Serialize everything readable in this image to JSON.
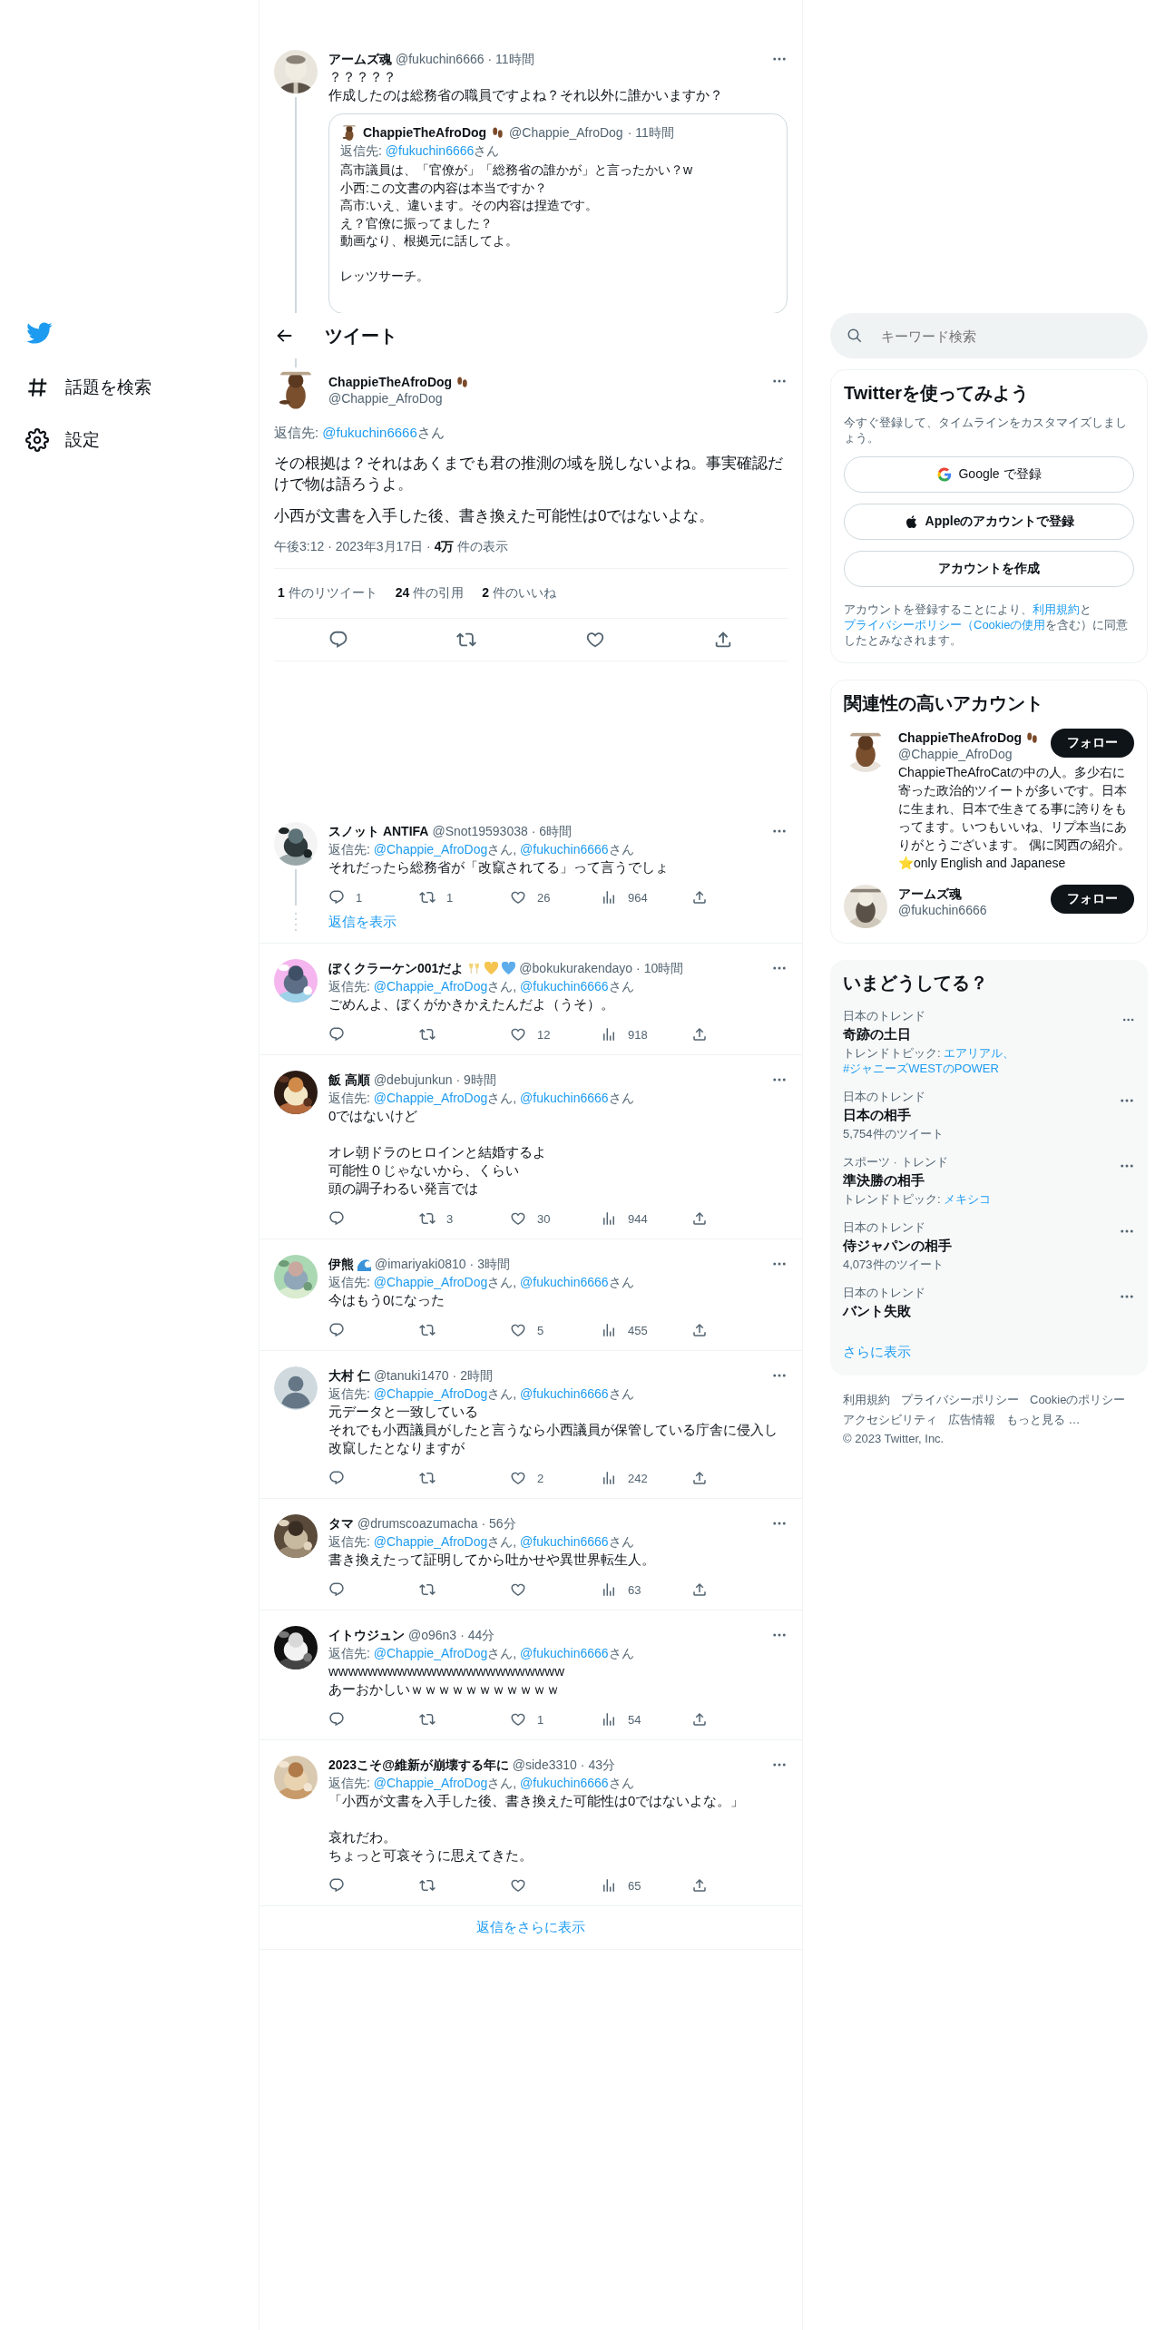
{
  "sidebar": {
    "items": [
      {
        "kind": "logo"
      },
      {
        "kind": "explore",
        "label": "話題を検索"
      },
      {
        "kind": "settings",
        "label": "設定"
      }
    ]
  },
  "parent_tweet": {
    "avatar": {
      "kind": "picture"
    },
    "name": "アームズ魂",
    "handle": "@fukuchin6666",
    "time": "· 11時間",
    "text": [
      [
        "？？？？？",
        "作成したのは総務省の職員ですよね？それ以外に誰かいますか？"
      ]
    ],
    "quote": {
      "avatar": {
        "kind": "picture"
      },
      "name": "ChappieTheAfroDog",
      "name_icons": [
        {
          "kind": "footprints"
        }
      ],
      "handle": "@Chappie_AfroDog",
      "time": "· 11時間",
      "reply_to": {
        "label": "返信先: ",
        "parts": [
          {
            "kind": "mention",
            "text": "@fukuchin6666"
          },
          {
            "kind": "plain",
            "text": "さん"
          }
        ]
      },
      "text": [
        [
          "高市議員は、「官僚が」「総務省の誰かが」と言ったかい？w",
          "小西:この文書の内容は本当ですか？",
          "高市:いえ、違います。その内容は捏造です。",
          "え？官僚に振ってました？",
          "動画なり、根拠元に話してよ。"
        ],
        [
          "レッツサーチ。"
        ]
      ]
    }
  },
  "header": {
    "title": "ツイート"
  },
  "main_tweet": {
    "avatar": {
      "kind": "picture"
    },
    "name": "ChappieTheAfroDog",
    "name_icons": [
      {
        "kind": "footprints"
      }
    ],
    "handle": "@Chappie_AfroDog",
    "reply_to": {
      "label": "返信先: ",
      "parts": [
        {
          "kind": "mention",
          "text": "@fukuchin6666"
        },
        {
          "kind": "plain",
          "text": "さん"
        }
      ]
    },
    "paragraphs": [
      "その根拠は？それはあくまでも君の推測の域を脱しないよね。事実確認だけで物は語ろうよ。",
      "小西が文書を入手した後、書き換えた可能性は0ではないよな。"
    ],
    "meta": "午後3:12 · 2023年3月17日 · **4万** 件の表示",
    "stats": [
      "**1** 件のリツイート",
      "**24** 件の引用",
      "**2** 件のいいね"
    ]
  },
  "replies": [
    {
      "avatar": {
        "kind": "picture"
      },
      "name": "スノット ANTIFA",
      "handle": "@Snot19593038",
      "time": "· 6時間",
      "reply_to": {
        "label": "返信先: ",
        "parts": [
          {
            "kind": "mention",
            "text": "@Chappie_AfroDog"
          },
          {
            "kind": "plain",
            "text": "さん, "
          },
          {
            "kind": "mention",
            "text": "@fukuchin6666"
          },
          {
            "kind": "plain",
            "text": "さん"
          }
        ]
      },
      "text": [
        [
          "それだったら総務省が「改竄されてる」って言うでしょ"
        ]
      ],
      "stats": {
        "reply": "1",
        "retweet": "1",
        "like": "26",
        "views": "964"
      },
      "show_replies": "返信を表示"
    },
    {
      "avatar": {
        "kind": "picture"
      },
      "name": "ぼくクラーケン001だよ",
      "name_icons": [
        {
          "kind": "glasses"
        },
        {
          "kind": "yellow-heart"
        },
        {
          "kind": "blue-heart"
        }
      ],
      "handle": "@bokukurakendayo",
      "time": "· 10時間",
      "reply_to": {
        "label": "返信先: ",
        "parts": [
          {
            "kind": "mention",
            "text": "@Chappie_AfroDog"
          },
          {
            "kind": "plain",
            "text": "さん, "
          },
          {
            "kind": "mention",
            "text": "@fukuchin6666"
          },
          {
            "kind": "plain",
            "text": "さん"
          }
        ]
      },
      "text": [
        [
          "ごめんよ、ぼくがかきかえたんだよ（うそ）。"
        ]
      ],
      "stats": {
        "like": "12",
        "views": "918"
      }
    },
    {
      "avatar": {
        "kind": "picture"
      },
      "name": "飯 高順",
      "handle": "@debujunkun",
      "time": "· 9時間",
      "reply_to": {
        "label": "返信先: ",
        "parts": [
          {
            "kind": "mention",
            "text": "@Chappie_AfroDog"
          },
          {
            "kind": "plain",
            "text": "さん, "
          },
          {
            "kind": "mention",
            "text": "@fukuchin6666"
          },
          {
            "kind": "plain",
            "text": "さん"
          }
        ]
      },
      "text": [
        [
          "0ではないけど"
        ],
        [
          "オレ朝ドラのヒロインと結婚するよ",
          "可能性０じゃないから、くらい",
          "頭の調子わるい発言では"
        ]
      ],
      "stats": {
        "retweet": "3",
        "like": "30",
        "views": "944"
      }
    },
    {
      "avatar": {
        "kind": "picture"
      },
      "name": "伊熊",
      "name_icons": [
        {
          "kind": "wave"
        }
      ],
      "handle": "@imariyaki0810",
      "time": "· 3時間",
      "reply_to": {
        "label": "返信先: ",
        "parts": [
          {
            "kind": "mention",
            "text": "@Chappie_AfroDog"
          },
          {
            "kind": "plain",
            "text": "さん, "
          },
          {
            "kind": "mention",
            "text": "@fukuchin6666"
          },
          {
            "kind": "plain",
            "text": "さん"
          }
        ]
      },
      "text": [
        [
          "今はもう0になった"
        ]
      ],
      "stats": {
        "like": "5",
        "views": "455"
      }
    },
    {
      "avatar": {
        "kind": "default"
      },
      "name": "大村 仁",
      "handle": "@tanuki1470",
      "time": "· 2時間",
      "reply_to": {
        "label": "返信先: ",
        "parts": [
          {
            "kind": "mention",
            "text": "@Chappie_AfroDog"
          },
          {
            "kind": "plain",
            "text": "さん, "
          },
          {
            "kind": "mention",
            "text": "@fukuchin6666"
          },
          {
            "kind": "plain",
            "text": "さん"
          }
        ]
      },
      "text": [
        [
          "元データと一致している",
          "それでも小西議員がしたと言うなら小西議員が保管している庁舎に侵入し改竄したとなりますが"
        ]
      ],
      "stats": {
        "like": "2",
        "views": "242"
      }
    },
    {
      "avatar": {
        "kind": "picture"
      },
      "name": "タマ",
      "handle": "@drumscoazumacha",
      "time": "· 56分",
      "reply_to": {
        "label": "返信先: ",
        "parts": [
          {
            "kind": "mention",
            "text": "@Chappie_AfroDog"
          },
          {
            "kind": "plain",
            "text": "さん, "
          },
          {
            "kind": "mention",
            "text": "@fukuchin6666"
          },
          {
            "kind": "plain",
            "text": "さん"
          }
        ]
      },
      "text": [
        [
          "書き換えたって証明してから吐かせや異世界転生人。"
        ]
      ],
      "stats": {
        "views": "63"
      }
    },
    {
      "avatar": {
        "kind": "picture"
      },
      "name": "イトウジュン",
      "handle": "@o96n3",
      "time": "· 44分",
      "reply_to": {
        "label": "返信先: ",
        "parts": [
          {
            "kind": "mention",
            "text": "@Chappie_AfroDog"
          },
          {
            "kind": "plain",
            "text": "さん, "
          },
          {
            "kind": "mention",
            "text": "@fukuchin6666"
          },
          {
            "kind": "plain",
            "text": "さん"
          }
        ]
      },
      "text": [
        [
          "wwwwwwwwwwwwwwwwwwwwwwww",
          "あーおかしいｗｗｗｗｗｗｗｗｗｗｗ"
        ]
      ],
      "stats": {
        "like": "1",
        "views": "54"
      }
    },
    {
      "avatar": {
        "kind": "picture"
      },
      "name": "2023こそ@維新が崩壊する年に",
      "handle": "@side3310",
      "time": "· 43分",
      "reply_to": {
        "label": "返信先: ",
        "parts": [
          {
            "kind": "mention",
            "text": "@Chappie_AfroDog"
          },
          {
            "kind": "plain",
            "text": "さん, "
          },
          {
            "kind": "mention",
            "text": "@fukuchin6666"
          },
          {
            "kind": "plain",
            "text": "さん"
          }
        ]
      },
      "text": [
        [
          "「小西が文書を入手した後、書き換えた可能性は0ではないよな。」"
        ],
        [
          "哀れだわ。",
          "ちょっと可哀そうに思えてきた。"
        ]
      ],
      "stats": {
        "views": "65"
      }
    }
  ],
  "show_more": "返信をさらに表示",
  "search": {
    "placeholder": "キーワード検索"
  },
  "signup": {
    "title": "Twitterを使ってみよう",
    "text": "今すぐ登録して、タイムラインをカスタマイズしましょう。",
    "buttons": [
      {
        "kind": "google",
        "label": "Google で登録"
      },
      {
        "kind": "apple",
        "label": "Appleのアカウントで登録"
      },
      {
        "kind": "plain",
        "label": "アカウントを作成"
      }
    ],
    "legal": [
      {
        "kind": "plain",
        "text": "アカウントを登録することにより、"
      },
      {
        "kind": "mention",
        "text": "利用規約"
      },
      {
        "kind": "plain",
        "text": "と"
      },
      {
        "kind": "mention",
        "text": "プライバシーポリシー（Cookieの使用"
      },
      {
        "kind": "plain",
        "text": "を含む）に同意したとみなされます。"
      }
    ]
  },
  "recommended": {
    "title": "関連性の高いアカウント",
    "accounts": [
      {
        "avatar": {
          "kind": "picture"
        },
        "name": "ChappieTheAfroDog",
        "name_icons": [
          {
            "kind": "footprints"
          }
        ],
        "handle": "@Chappie_AfroDog",
        "bio": "ChappieTheAfroCatの中の人。多少右に寄った政治的ツイートが多いです。日本に生まれ、日本で生きてる事に誇りをもってます。いつもいいね、リプ本当にありがとうございます。 偶に関西の紹介。⭐only English and Japanese",
        "follow": "フォロー"
      },
      {
        "avatar": {
          "kind": "picture"
        },
        "name": "アームズ魂",
        "handle": "@fukuchin6666",
        "follow": "フォロー"
      }
    ]
  },
  "trends": {
    "title": "いまどうしてる？",
    "items": [
      {
        "category": "日本のトレンド",
        "title": "奇跡の土日",
        "sub": [
          {
            "kind": "plain",
            "text": "トレンドトピック: "
          },
          {
            "kind": "mention",
            "text": "エアリアル、"
          },
          {
            "kind": "mention",
            "text": "#ジャニーズWESTのPOWER"
          }
        ]
      },
      {
        "category": "日本のトレンド",
        "title": "日本の相手",
        "sub": [
          {
            "kind": "plain",
            "text": "5,754件のツイート"
          }
        ]
      },
      {
        "category": "スポーツ · トレンド",
        "title": "準決勝の相手",
        "sub": [
          {
            "kind": "plain",
            "text": "トレンドトピック: "
          },
          {
            "kind": "mention",
            "text": "メキシコ"
          }
        ]
      },
      {
        "category": "日本のトレンド",
        "title": "侍ジャパンの相手",
        "sub": [
          {
            "kind": "plain",
            "text": "4,073件のツイート"
          }
        ]
      },
      {
        "category": "日本のトレンド",
        "title": "バント失敗"
      }
    ],
    "more": "さらに表示"
  },
  "footer": {
    "links": [
      "利用規約",
      "プライバシーポリシー",
      "Cookieのポリシー",
      "アクセシビリティ",
      "広告情報",
      "もっと見る …"
    ],
    "copyright": "© 2023 Twitter, Inc."
  }
}
